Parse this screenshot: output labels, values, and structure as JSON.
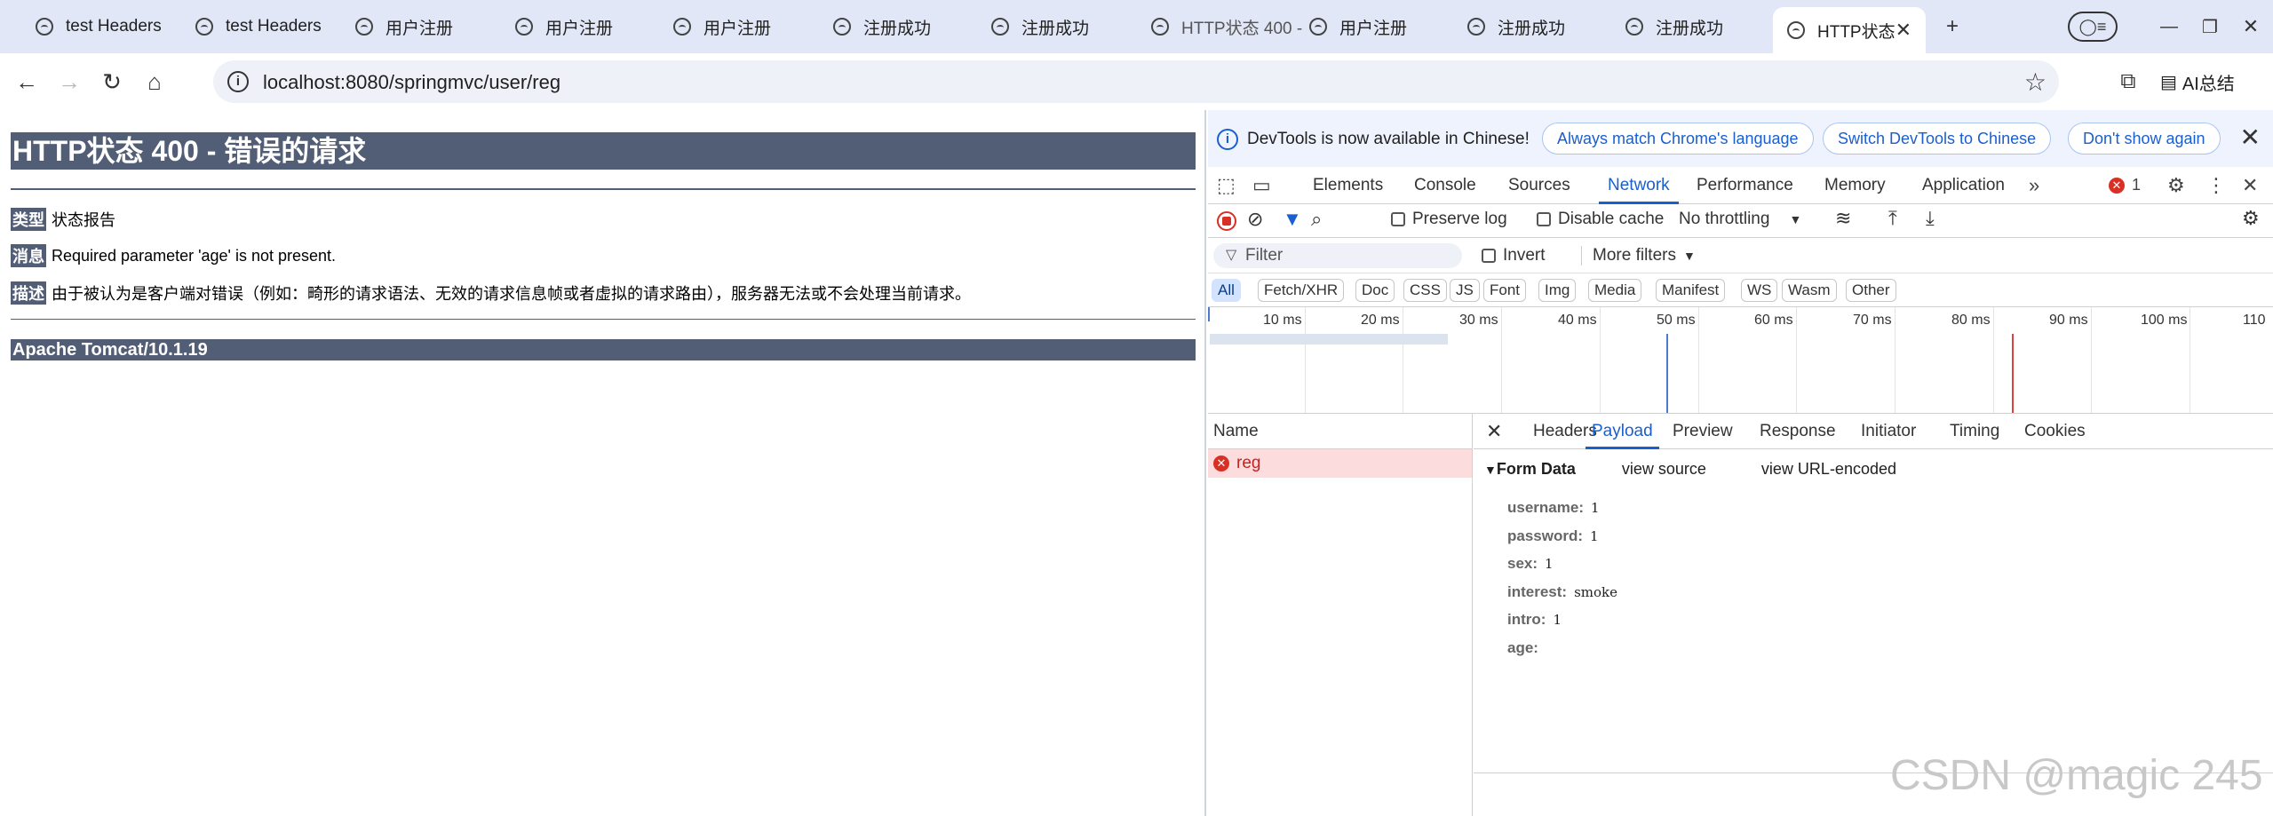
{
  "tabs": [
    {
      "label": "test Headers"
    },
    {
      "label": "test Headers"
    },
    {
      "label": "用户注册"
    },
    {
      "label": "用户注册"
    },
    {
      "label": "用户注册"
    },
    {
      "label": "注册成功"
    },
    {
      "label": "注册成功"
    },
    {
      "label": "HTTP状态 400 -"
    },
    {
      "label": "用户注册"
    },
    {
      "label": "注册成功"
    },
    {
      "label": "注册成功"
    },
    {
      "label": "HTTP状态"
    }
  ],
  "toolbar": {
    "url": "localhost:8080/springmvc/user/reg",
    "ai_label": "AI总结"
  },
  "page": {
    "title": "HTTP状态 400 - 错误的请求",
    "type_label": "类型",
    "type_value": "状态报告",
    "message_label": "消息",
    "message_value": "Required parameter 'age' is not present.",
    "desc_label": "描述",
    "desc_value": "由于被认为是客户端对错误（例如：畸形的请求语法、无效的请求信息帧或者虚拟的请求路由），服务器无法或不会处理当前请求。",
    "footer": "Apache Tomcat/10.1.19"
  },
  "devtools": {
    "infobar": {
      "message": "DevTools is now available in Chinese!",
      "btn_match": "Always match Chrome's language",
      "btn_switch": "Switch DevTools to Chinese",
      "btn_dont": "Don't show again"
    },
    "tabs": [
      "Elements",
      "Console",
      "Sources",
      "Network",
      "Performance",
      "Memory",
      "Application"
    ],
    "error_count": "1",
    "network_toolbar": {
      "preserve_log": "Preserve log",
      "disable_cache": "Disable cache",
      "throttling": "No throttling"
    },
    "filter": {
      "placeholder": "Filter",
      "invert": "Invert",
      "more_filters": "More filters"
    },
    "type_filters": [
      "All",
      "Fetch/XHR",
      "Doc",
      "CSS",
      "JS",
      "Font",
      "Img",
      "Media",
      "Manifest",
      "WS",
      "Wasm",
      "Other"
    ],
    "timeline_labels": [
      "10 ms",
      "20 ms",
      "30 ms",
      "40 ms",
      "50 ms",
      "60 ms",
      "70 ms",
      "80 ms",
      "90 ms",
      "100 ms",
      "110"
    ],
    "request_list": {
      "header": "Name",
      "rows": [
        {
          "name": "reg"
        }
      ]
    },
    "detail_tabs": [
      "Headers",
      "Payload",
      "Preview",
      "Response",
      "Initiator",
      "Timing",
      "Cookies"
    ],
    "payload": {
      "section": "Form Data",
      "view_source": "view source",
      "view_url_encoded": "view URL-encoded",
      "fields": [
        {
          "key": "username:",
          "value": "1"
        },
        {
          "key": "password:",
          "value": "1"
        },
        {
          "key": "sex:",
          "value": "1"
        },
        {
          "key": "interest:",
          "value": "smoke"
        },
        {
          "key": "intro:",
          "value": "1"
        },
        {
          "key": "age:",
          "value": ""
        }
      ]
    }
  },
  "watermark": "CSDN @magic 245",
  "colors": {
    "tomcat_bar": "#525d76",
    "accent": "#1a5fd0",
    "error": "#d93025"
  }
}
